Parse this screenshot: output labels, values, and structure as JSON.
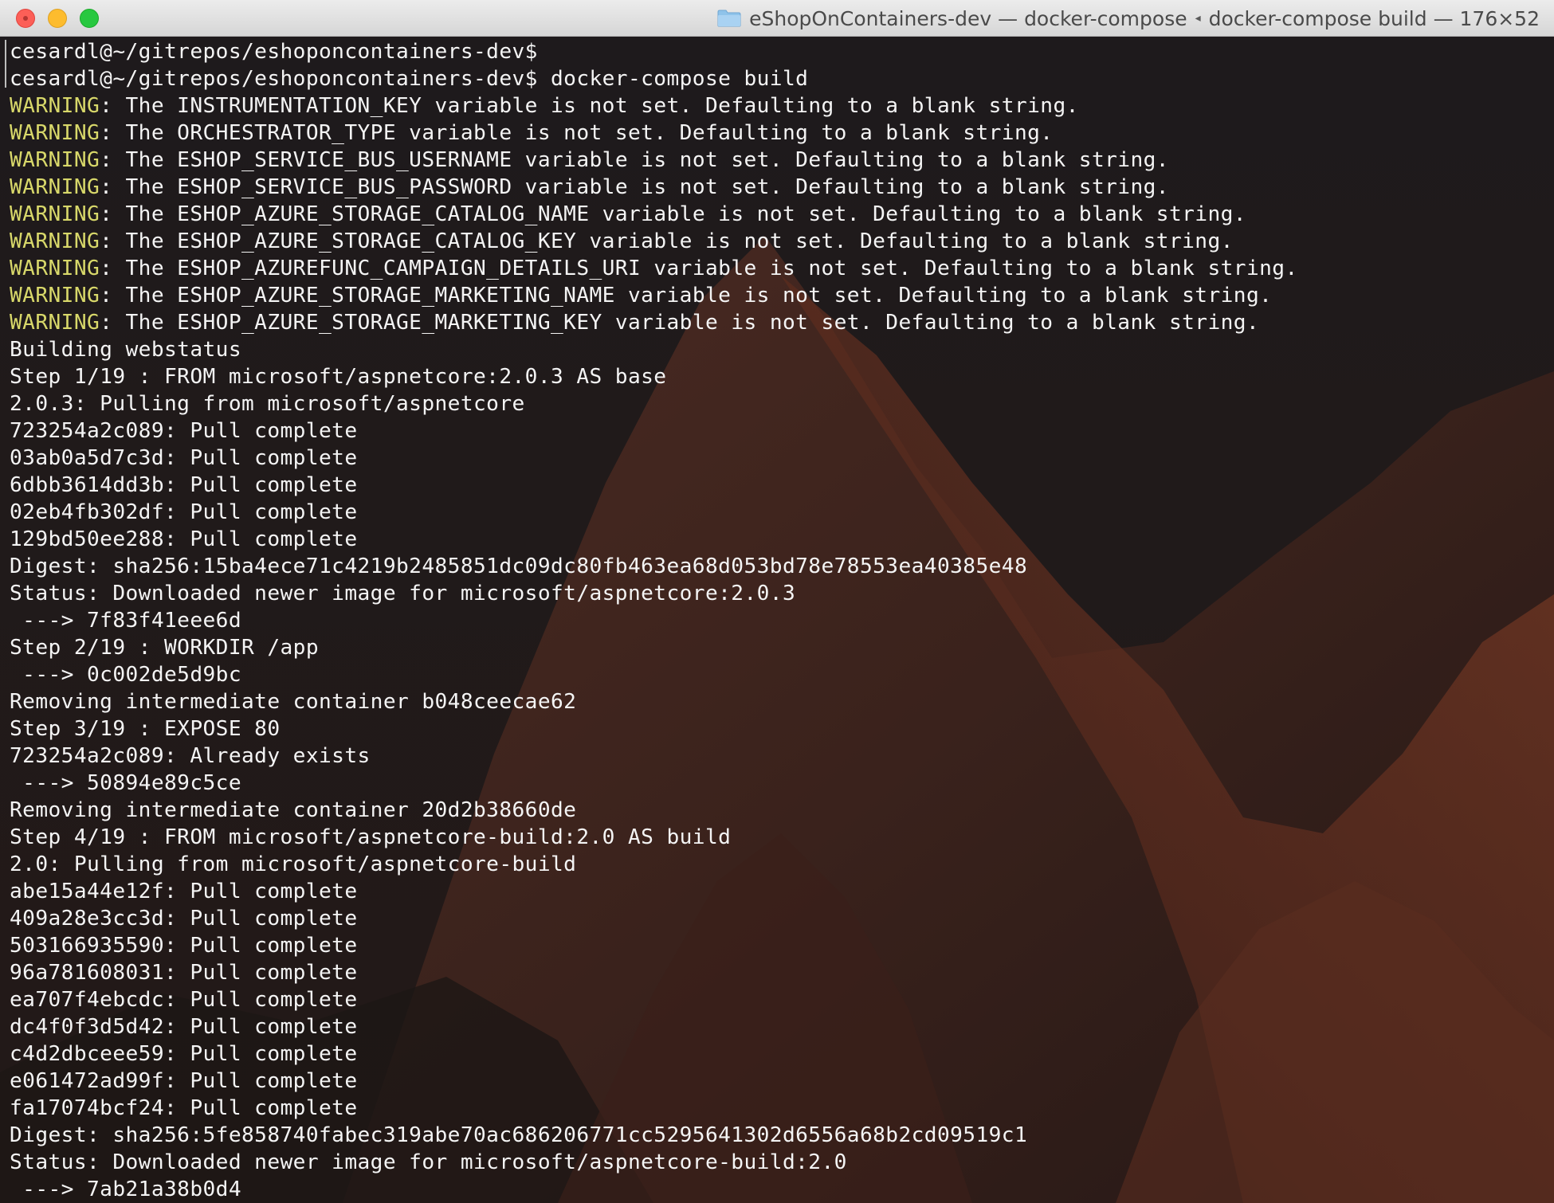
{
  "window": {
    "title": {
      "folder": "eShopOnContainers-dev",
      "separator1": "—",
      "process": "docker-compose",
      "command": "docker-compose build",
      "separator2": "—",
      "size": "176×52"
    }
  },
  "colors": {
    "warning": "#d8d86a",
    "text": "#f4f4f4",
    "titlebar": "#e4e4e4",
    "close": "#fc5f57",
    "minimize": "#fdbc2e",
    "zoom": "#28c840"
  },
  "terminal": {
    "lines": [
      {
        "prefix": "",
        "text": "cesardl@~/gitrepos/eshoponcontainers-dev$"
      },
      {
        "prefix": "",
        "text": "cesardl@~/gitrepos/eshoponcontainers-dev$ docker-compose build"
      },
      {
        "prefix": "WARNING",
        "text": ": The INSTRUMENTATION_KEY variable is not set. Defaulting to a blank string."
      },
      {
        "prefix": "WARNING",
        "text": ": The ORCHESTRATOR_TYPE variable is not set. Defaulting to a blank string."
      },
      {
        "prefix": "WARNING",
        "text": ": The ESHOP_SERVICE_BUS_USERNAME variable is not set. Defaulting to a blank string."
      },
      {
        "prefix": "WARNING",
        "text": ": The ESHOP_SERVICE_BUS_PASSWORD variable is not set. Defaulting to a blank string."
      },
      {
        "prefix": "WARNING",
        "text": ": The ESHOP_AZURE_STORAGE_CATALOG_NAME variable is not set. Defaulting to a blank string."
      },
      {
        "prefix": "WARNING",
        "text": ": The ESHOP_AZURE_STORAGE_CATALOG_KEY variable is not set. Defaulting to a blank string."
      },
      {
        "prefix": "WARNING",
        "text": ": The ESHOP_AZUREFUNC_CAMPAIGN_DETAILS_URI variable is not set. Defaulting to a blank string."
      },
      {
        "prefix": "WARNING",
        "text": ": The ESHOP_AZURE_STORAGE_MARKETING_NAME variable is not set. Defaulting to a blank string."
      },
      {
        "prefix": "WARNING",
        "text": ": The ESHOP_AZURE_STORAGE_MARKETING_KEY variable is not set. Defaulting to a blank string."
      },
      {
        "prefix": "",
        "text": "Building webstatus"
      },
      {
        "prefix": "",
        "text": "Step 1/19 : FROM microsoft/aspnetcore:2.0.3 AS base"
      },
      {
        "prefix": "",
        "text": "2.0.3: Pulling from microsoft/aspnetcore"
      },
      {
        "prefix": "",
        "text": "723254a2c089: Pull complete"
      },
      {
        "prefix": "",
        "text": "03ab0a5d7c3d: Pull complete"
      },
      {
        "prefix": "",
        "text": "6dbb3614dd3b: Pull complete"
      },
      {
        "prefix": "",
        "text": "02eb4fb302df: Pull complete"
      },
      {
        "prefix": "",
        "text": "129bd50ee288: Pull complete"
      },
      {
        "prefix": "",
        "text": "Digest: sha256:15ba4ece71c4219b2485851dc09dc80fb463ea68d053bd78e78553ea40385e48"
      },
      {
        "prefix": "",
        "text": "Status: Downloaded newer image for microsoft/aspnetcore:2.0.3"
      },
      {
        "prefix": "",
        "text": " ---> 7f83f41eee6d"
      },
      {
        "prefix": "",
        "text": "Step 2/19 : WORKDIR /app"
      },
      {
        "prefix": "",
        "text": " ---> 0c002de5d9bc"
      },
      {
        "prefix": "",
        "text": "Removing intermediate container b048ceecae62"
      },
      {
        "prefix": "",
        "text": "Step 3/19 : EXPOSE 80"
      },
      {
        "prefix": "",
        "text": "723254a2c089: Already exists"
      },
      {
        "prefix": "",
        "text": " ---> 50894e89c5ce"
      },
      {
        "prefix": "",
        "text": "Removing intermediate container 20d2b38660de"
      },
      {
        "prefix": "",
        "text": "Step 4/19 : FROM microsoft/aspnetcore-build:2.0 AS build"
      },
      {
        "prefix": "",
        "text": "2.0: Pulling from microsoft/aspnetcore-build"
      },
      {
        "prefix": "",
        "text": "abe15a44e12f: Pull complete"
      },
      {
        "prefix": "",
        "text": "409a28e3cc3d: Pull complete"
      },
      {
        "prefix": "",
        "text": "503166935590: Pull complete"
      },
      {
        "prefix": "",
        "text": "96a781608031: Pull complete"
      },
      {
        "prefix": "",
        "text": "ea707f4ebcdc: Pull complete"
      },
      {
        "prefix": "",
        "text": "dc4f0f3d5d42: Pull complete"
      },
      {
        "prefix": "",
        "text": "c4d2dbceee59: Pull complete"
      },
      {
        "prefix": "",
        "text": "e061472ad99f: Pull complete"
      },
      {
        "prefix": "",
        "text": "fa17074bcf24: Pull complete"
      },
      {
        "prefix": "",
        "text": "Digest: sha256:5fe858740fabec319abe70ac686206771cc5295641302d6556a68b2cd09519c1"
      },
      {
        "prefix": "",
        "text": "Status: Downloaded newer image for microsoft/aspnetcore-build:2.0"
      },
      {
        "prefix": "",
        "text": " ---> 7ab21a38b0d4"
      }
    ]
  }
}
